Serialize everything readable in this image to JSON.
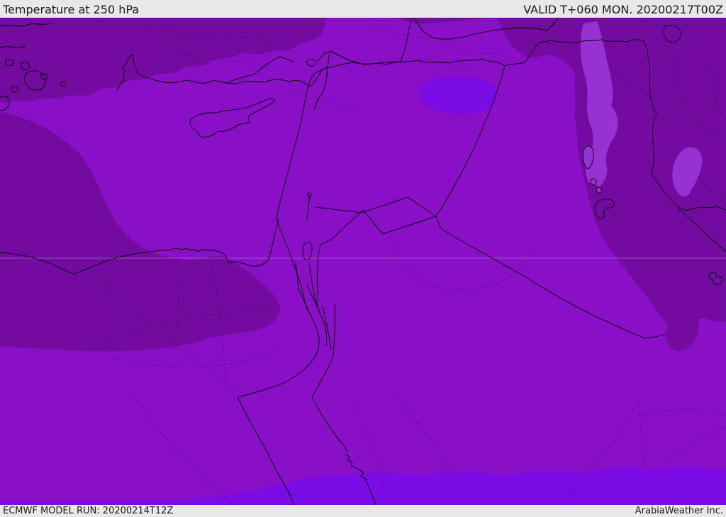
{
  "header": {
    "title": "Temperature at 250 hPa",
    "valid_time": "VALID T+060 MON. 20200217T00Z"
  },
  "footer": {
    "model_run": "ECMWF MODEL RUN: 20200214T12Z",
    "brand": "ArabiaWeather Inc."
  },
  "map": {
    "description": "ECMWF temperature shading at 250 hPa over the Middle East with coastlines, country borders and dotted admin boundaries",
    "palette": {
      "base": "#8a10c8",
      "dark": "#740ba0",
      "light": "#9632d2",
      "bright": "#7a0be4",
      "ink": "#0a0310",
      "grid": "rgba(230,195,255,0.45)",
      "chrome_bg": "#e8e8e8",
      "chrome_text": "#1a1a1a"
    }
  }
}
